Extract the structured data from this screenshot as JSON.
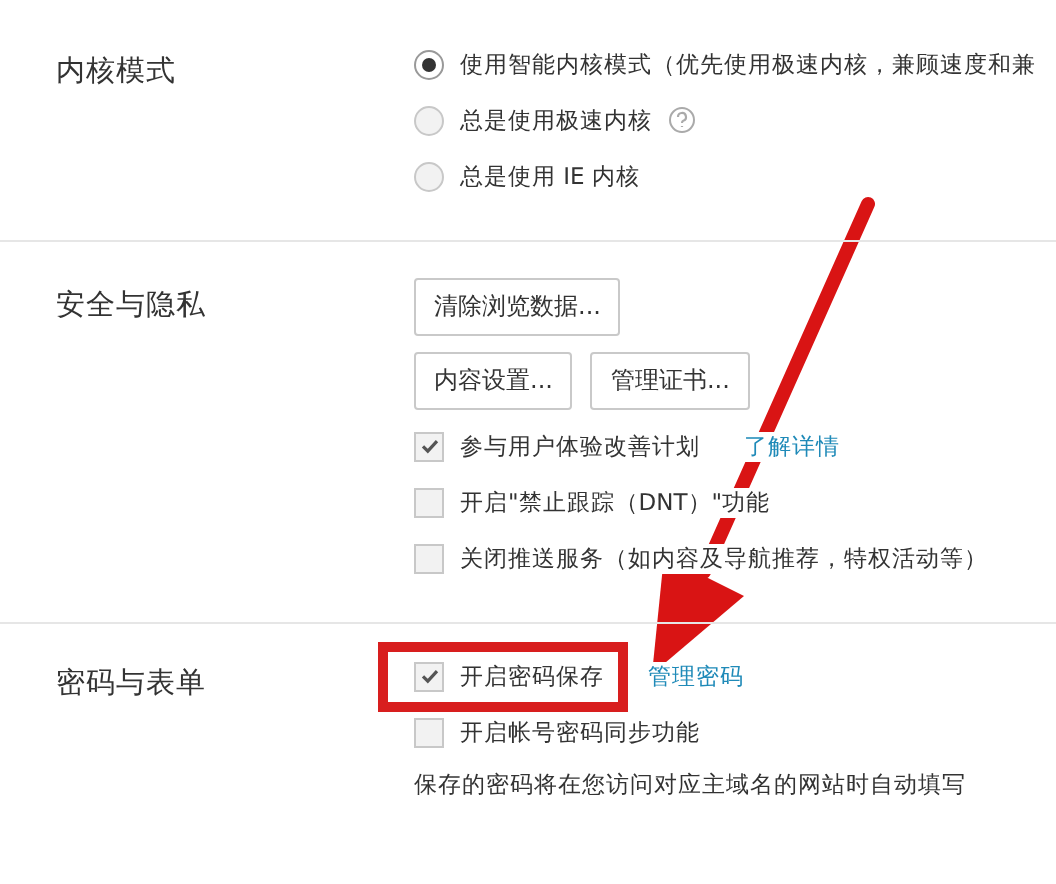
{
  "sections": [
    {
      "title": "内核模式",
      "items": [
        {
          "kind": "radio",
          "label": "使用智能内核模式（优先使用极速内核，兼顾速度和兼",
          "selected": true
        },
        {
          "kind": "radio",
          "label": "总是使用极速内核",
          "selected": false,
          "help": true
        },
        {
          "kind": "radio",
          "label": "总是使用 IE 内核",
          "selected": false
        }
      ]
    },
    {
      "title": "安全与隐私",
      "items": [
        {
          "kind": "buttons",
          "buttons": [
            "清除浏览数据..."
          ]
        },
        {
          "kind": "buttons",
          "buttons": [
            "内容设置...",
            "管理证书..."
          ]
        },
        {
          "kind": "checkbox",
          "label": "参与用户体验改善计划",
          "checked": true,
          "link": "了解详情"
        },
        {
          "kind": "checkbox",
          "label": "开启\"禁止跟踪（DNT）\"功能",
          "checked": false
        },
        {
          "kind": "checkbox",
          "label": "关闭推送服务（如内容及导航推荐，特权活动等）",
          "checked": false
        }
      ]
    },
    {
      "title": "密码与表单",
      "items": [
        {
          "kind": "checkbox",
          "label": "开启密码保存",
          "checked": true,
          "link": "管理密码",
          "highlighted": true
        },
        {
          "kind": "checkbox",
          "label": "开启帐号密码同步功能",
          "checked": false
        },
        {
          "kind": "note",
          "label": "保存的密码将在您访问对应主域名的网站时自动填写"
        }
      ]
    }
  ]
}
